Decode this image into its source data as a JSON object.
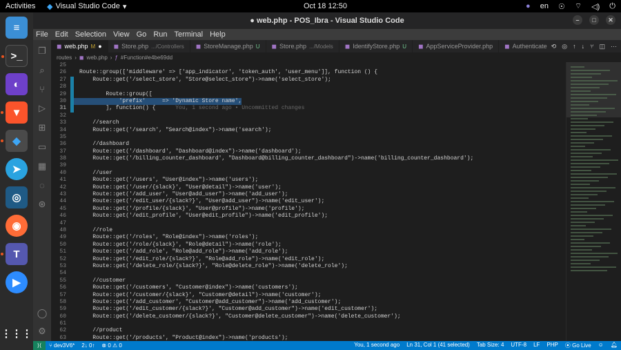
{
  "topbar": {
    "activities": "Activities",
    "app_name": "Visual Studio Code",
    "clock": "Oct 18  12:50",
    "language": "en"
  },
  "window": {
    "title": "● web.php - POS_Ibra - Visual Studio Code"
  },
  "menu": [
    "File",
    "Edit",
    "Selection",
    "View",
    "Go",
    "Run",
    "Terminal",
    "Help"
  ],
  "tabs": [
    {
      "name": "web.php",
      "dir": "",
      "mod": "M",
      "active": true
    },
    {
      "name": "Store.php",
      "dir": ".../Controllers",
      "mod": ""
    },
    {
      "name": "StoreManage.php",
      "dir": "",
      "mod": "U"
    },
    {
      "name": "Store.php",
      "dir": ".../Models",
      "mod": ""
    },
    {
      "name": "IdentifyStore.php",
      "dir": "",
      "mod": "U"
    },
    {
      "name": "AppServiceProvider.php",
      "dir": "",
      "mod": ""
    },
    {
      "name": "AuthenticateUser.php",
      "dir": "",
      "mod": "U"
    }
  ],
  "breadcrumb": {
    "a": "routes",
    "b": "web.php",
    "c": "#Function#e4be69dd"
  },
  "code": [
    {
      "n": "25",
      "t": ""
    },
    {
      "n": "26",
      "t": "Route::group(['middleware' => ['app_indicator', 'token_auth', 'user_menu']], function () {"
    },
    {
      "n": "27",
      "t": "    Route::get('/select_store', \"Store@select_store\")->name('select_store');",
      "g": 1
    },
    {
      "n": "28",
      "t": "",
      "g": 1
    },
    {
      "n": "29",
      "t": "        Route::group([",
      "g": 1
    },
    {
      "n": "30",
      "t": "            'prefix'     => 'Dynamic Store name',",
      "g": 1,
      "sel": 1
    },
    {
      "n": "31",
      "t": "        ], function() {",
      "g": 1,
      "hint": "      You, 1 second ago • Uncommitted changes"
    },
    {
      "n": "32",
      "t": ""
    },
    {
      "n": "33",
      "t": "    //search"
    },
    {
      "n": "34",
      "t": "    Route::get('/search', \"Search@index\")->name('search');"
    },
    {
      "n": "35",
      "t": ""
    },
    {
      "n": "36",
      "t": "    //dashboard"
    },
    {
      "n": "37",
      "t": "    Route::get('/dashboard', \"Dashboard@index\")->name('dashboard');"
    },
    {
      "n": "38",
      "t": "    Route::get('/billing_counter_dashboard', \"Dashboard@billing_counter_dashboard\")->name('billing_counter_dashboard');"
    },
    {
      "n": "39",
      "t": ""
    },
    {
      "n": "40",
      "t": "    //user"
    },
    {
      "n": "41",
      "t": "    Route::get('/users', \"User@index\")->name('users');"
    },
    {
      "n": "42",
      "t": "    Route::get('/user/{slack}', \"User@detail\")->name('user');"
    },
    {
      "n": "43",
      "t": "    Route::get('/add_user', \"User@add_user\")->name('add_user');"
    },
    {
      "n": "44",
      "t": "    Route::get('/edit_user/{slack?}', \"User@add_user\")->name('edit_user');"
    },
    {
      "n": "45",
      "t": "    Route::get('/profile/{slack}', \"User@profile\")->name('profile');"
    },
    {
      "n": "46",
      "t": "    Route::get('/edit_profile', \"User@edit_profile\")->name('edit_profile');"
    },
    {
      "n": "47",
      "t": ""
    },
    {
      "n": "48",
      "t": "    //role"
    },
    {
      "n": "49",
      "t": "    Route::get('/roles', \"Role@index\")->name('roles');"
    },
    {
      "n": "50",
      "t": "    Route::get('/role/{slack}', \"Role@detail\")->name('role');"
    },
    {
      "n": "51",
      "t": "    Route::get('/add_role', \"Role@add_role\")->name('add_role');"
    },
    {
      "n": "52",
      "t": "    Route::get('/edit_role/{slack?}', \"Role@add_role\")->name('edit_role');"
    },
    {
      "n": "53",
      "t": "    Route::get('/delete_role/{slack?}', \"Role@delete_role\")->name('delete_role');"
    },
    {
      "n": "54",
      "t": ""
    },
    {
      "n": "55",
      "t": "    //customer"
    },
    {
      "n": "56",
      "t": "    Route::get('/customers', \"Customer@index\")->name('customers');"
    },
    {
      "n": "57",
      "t": "    Route::get('/customer/{slack}', \"Customer@detail\")->name('customer');"
    },
    {
      "n": "58",
      "t": "    Route::get('/add_customer', \"Customer@add_customer\")->name('add_customer');"
    },
    {
      "n": "59",
      "t": "    Route::get('/edit_customer/{slack?}', \"Customer@add_customer\")->name('edit_customer');"
    },
    {
      "n": "60",
      "t": "    Route::get('/delete_customer/{slack?}', \"Customer@delete_customer\")->name('delete_customer');"
    },
    {
      "n": "61",
      "t": ""
    },
    {
      "n": "62",
      "t": "    //product"
    },
    {
      "n": "63",
      "t": "    Route::get('/products', \"Product@index\")->name('products');"
    }
  ],
  "status": {
    "branch": "dev3V6*",
    "sync": "2↓ 0↑",
    "errors": "⊗ 0 ⚠ 0",
    "blame": "You, 1 second ago",
    "position": "Ln 31, Col 1 (41 selected)",
    "tabsize": "Tab Size: 4",
    "encoding": "UTF-8",
    "eol": "LF",
    "lang": "PHP",
    "golive": "Go Live"
  },
  "colors": {
    "accent": "#007acc",
    "selection": "#264f78"
  }
}
